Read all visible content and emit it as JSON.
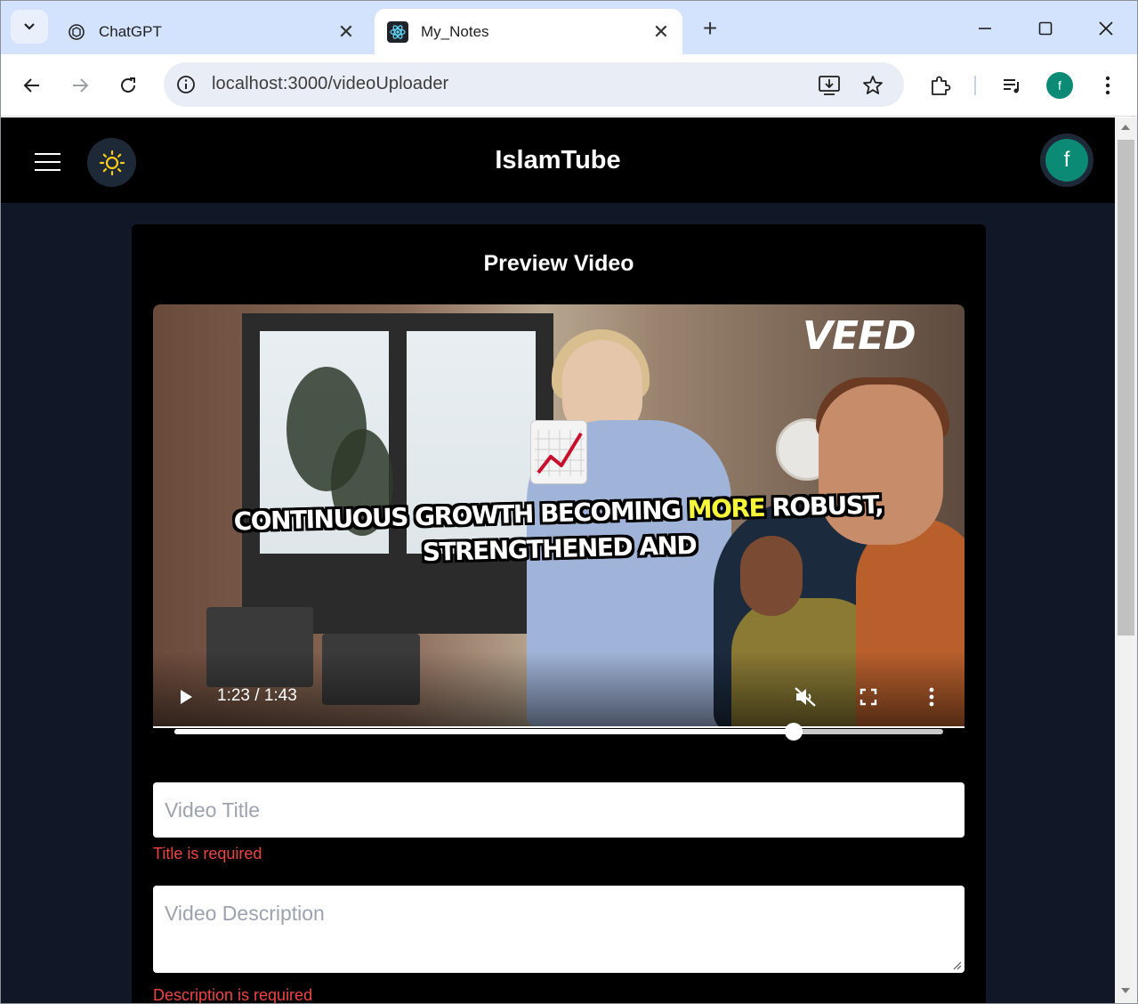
{
  "browser": {
    "tabs": [
      {
        "title": "ChatGPT",
        "favicon": "chatgpt-icon",
        "active": false
      },
      {
        "title": "My_Notes",
        "favicon": "react-icon",
        "active": true
      }
    ],
    "url": "localhost:3000/videoUploader",
    "profile_initial": "f"
  },
  "app": {
    "brand": "IslamTube",
    "avatar_initial": "f",
    "theme_icon": "sun-icon"
  },
  "card": {
    "title": "Preview Video",
    "video": {
      "watermark": "VEED",
      "caption_line1_a": "CONTINUOUS GROWTH BECOMING ",
      "caption_highlight": "MORE",
      "caption_line1_b": " ROBUST,",
      "caption_line2": "STRENGTHENED AND",
      "time_display": "1:23 / 1:43",
      "progress": 0.806,
      "muted": true
    },
    "title_field": {
      "placeholder": "Video Title",
      "value": "",
      "error": "Title is required"
    },
    "description_field": {
      "placeholder": "Video Description",
      "value": "",
      "error": "Description is required"
    }
  },
  "colors": {
    "page_bg": "#101828",
    "header_bg": "#000000",
    "avatar_bg": "#0b8a76",
    "error": "#ef4444",
    "caption_highlight": "#f5f53a"
  }
}
